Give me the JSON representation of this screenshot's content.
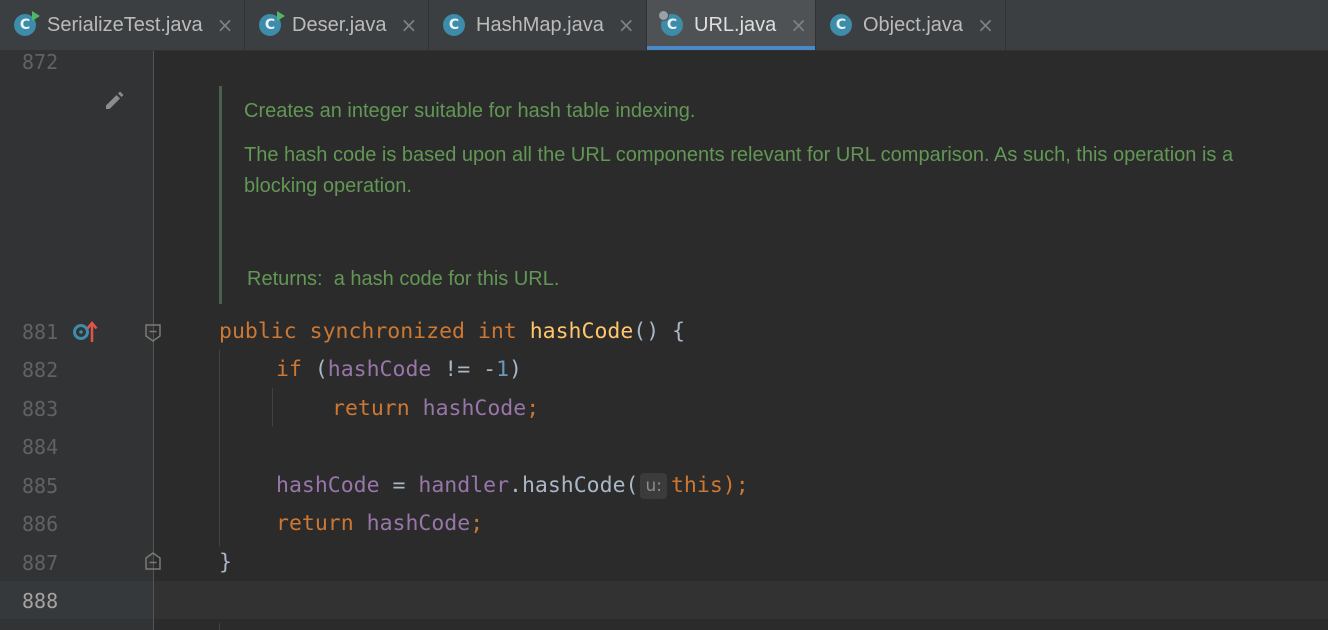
{
  "tabs": [
    {
      "label": "SerializeTest.java",
      "icon": "class-run-icon",
      "close": "×",
      "active": false
    },
    {
      "label": "Deser.java",
      "icon": "class-run-icon",
      "close": "×",
      "active": false
    },
    {
      "label": "HashMap.java",
      "icon": "class-icon",
      "close": "×",
      "active": false
    },
    {
      "label": "URL.java",
      "icon": "class-locked-icon",
      "close": "×",
      "active": true
    },
    {
      "label": "Object.java",
      "icon": "class-icon",
      "close": "×",
      "active": false
    }
  ],
  "tab_icon_letter": "C",
  "gutter": {
    "line_numbers": [
      "872",
      "881",
      "882",
      "883",
      "884",
      "885",
      "886",
      "887",
      "888"
    ],
    "icons": [
      "edit-pencil-icon",
      "override-method-icon",
      "fold-icon"
    ]
  },
  "doc": {
    "line1": "Creates an integer suitable for hash table indexing.",
    "line2a": "The hash code is based upon all the URL components relevant for URL comparison. As such, this operation is a",
    "line2b": "blocking operation.",
    "returns_label": "Returns:",
    "returns_text": "a hash code for this URL."
  },
  "code": {
    "l881": {
      "k1": "public",
      "k2": "synchronized",
      "k3": "int",
      "fn": "hashCode",
      "rest": "() {"
    },
    "l882": {
      "kw": "if",
      "p1": " (",
      "fld": "hashCode",
      "op": " != -",
      "num": "1",
      "p2": ")"
    },
    "l883": {
      "kw": "return",
      "fld": "hashCode",
      "semi": ";"
    },
    "l885": {
      "fld": "hashCode",
      "eq": " = ",
      "fld2": "handler",
      "call": ".hashCode(",
      "hint": "u:",
      "kw": "this",
      "end": ");"
    },
    "l886": {
      "kw": "return",
      "fld": "hashCode",
      "semi": ";"
    },
    "l887": {
      "brace": "}"
    }
  },
  "colors": {
    "background": "#2b2b2b",
    "keyword": "#cc7832",
    "method": "#ffc66d",
    "field": "#9876aa",
    "number": "#6897bb",
    "doc_comment": "#629755",
    "tab_accent": "#4a88c7"
  }
}
